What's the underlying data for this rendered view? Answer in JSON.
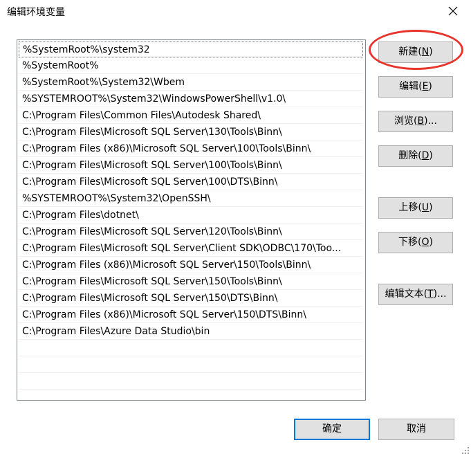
{
  "dialog": {
    "title": "编辑环境变量"
  },
  "path_list": {
    "selected_index": 0,
    "items": [
      "%SystemRoot%\\system32",
      "%SystemRoot%",
      "%SystemRoot%\\System32\\Wbem",
      "%SYSTEMROOT%\\System32\\WindowsPowerShell\\v1.0\\",
      "C:\\Program Files\\Common Files\\Autodesk Shared\\",
      "C:\\Program Files\\Microsoft SQL Server\\130\\Tools\\Binn\\",
      "C:\\Program Files (x86)\\Microsoft SQL Server\\100\\Tools\\Binn\\",
      "C:\\Program Files\\Microsoft SQL Server\\100\\Tools\\Binn\\",
      "C:\\Program Files\\Microsoft SQL Server\\100\\DTS\\Binn\\",
      "%SYSTEMROOT%\\System32\\OpenSSH\\",
      "C:\\Program Files\\dotnet\\",
      "C:\\Program Files\\Microsoft SQL Server\\120\\Tools\\Binn\\",
      "C:\\Program Files\\Microsoft SQL Server\\Client SDK\\ODBC\\170\\Too...",
      "C:\\Program Files (x86)\\Microsoft SQL Server\\150\\Tools\\Binn\\",
      "C:\\Program Files\\Microsoft SQL Server\\150\\Tools\\Binn\\",
      "C:\\Program Files\\Microsoft SQL Server\\150\\DTS\\Binn\\",
      "C:\\Program Files (x86)\\Microsoft SQL Server\\150\\DTS\\Binn\\",
      "C:\\Program Files\\Azure Data Studio\\bin",
      "",
      "",
      ""
    ]
  },
  "buttons": {
    "new": {
      "label": "新建(",
      "key": "N",
      "suffix": ")"
    },
    "edit": {
      "label": "编辑(",
      "key": "E",
      "suffix": ")"
    },
    "browse": {
      "label": "浏览(",
      "key": "B",
      "suffix": ")..."
    },
    "delete": {
      "label": "删除(",
      "key": "D",
      "suffix": ")"
    },
    "move_up": {
      "label": "上移(",
      "key": "U",
      "suffix": ")"
    },
    "move_down": {
      "label": "下移(",
      "key": "O",
      "suffix": ")"
    },
    "edit_text": {
      "label": "编辑文本(",
      "key": "T",
      "suffix": ")..."
    },
    "ok": {
      "label": "确定"
    },
    "cancel": {
      "label": "取消"
    }
  },
  "colors": {
    "annotation": "#e8342a",
    "default_button_border": "#0078d7"
  }
}
